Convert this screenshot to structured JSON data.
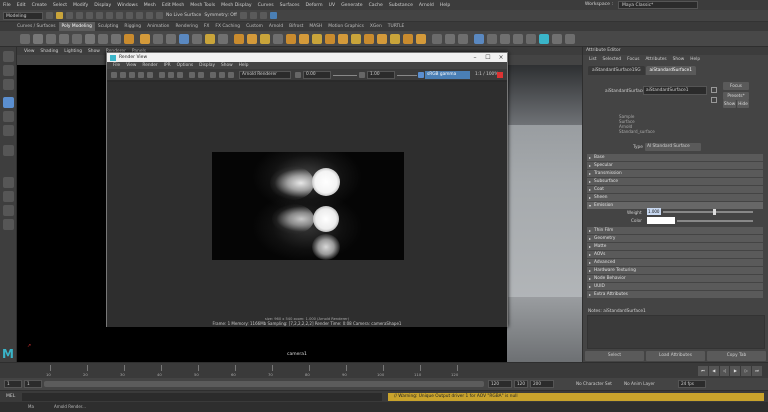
{
  "menubar": {
    "items": [
      "File",
      "Edit",
      "Create",
      "Select",
      "Modify",
      "Display",
      "Windows",
      "Mesh",
      "Edit Mesh",
      "Mesh Tools",
      "Mesh Display",
      "Curves",
      "Surfaces",
      "Deform",
      "UV",
      "Generate",
      "Cache",
      "Substance",
      "Arnold",
      "Help"
    ],
    "workspace_label": "Workspace :",
    "workspace_value": "Maya Classic*"
  },
  "statusline": {
    "menuset": "Modeling",
    "live_surface": "No Live Surface",
    "symmetry": "Symmetry: Off"
  },
  "shelf_tabs": [
    "Curves / Surfaces",
    "Poly Modeling",
    "Sculpting",
    "Rigging",
    "Animation",
    "Rendering",
    "FX",
    "FX Caching",
    "Custom",
    "Arnold",
    "Bifrost",
    "MASH",
    "Motion Graphics",
    "XGen",
    "TURTLE"
  ],
  "shelf_active_tab": 1,
  "viewport": {
    "menus": [
      "View",
      "Shading",
      "Lighting",
      "Show",
      "Renderer",
      "Panels"
    ],
    "camera_label": "camera1"
  },
  "render_view": {
    "title": "Render View",
    "menus": [
      "File",
      "View",
      "Render",
      "IPR",
      "Options",
      "Display",
      "Show",
      "Help"
    ],
    "renderer": "Arnold Renderer",
    "exposure": "0.00",
    "gamma": "1.00",
    "color_space": "sRGB gamma",
    "ratio": "1:1 / 100%",
    "info_line1": "size: 960 x 540  zoom: 1.000    (Arnold Renderer)",
    "info_line2": "Frame: 1    Memory: 1166Mb    Sampling: [7,2,2,2,2,2]    Render Time: 0:08    Camera: cameraShape1"
  },
  "attribute_editor": {
    "header": "Attribute Editor",
    "menus": [
      "List",
      "Selected",
      "Focus",
      "Attributes",
      "Show",
      "Help"
    ],
    "tabs": [
      "aiStandardSurface1SG",
      "aiStandardSurface1"
    ],
    "active_tab": 1,
    "shader_label": "aiStandardSurface:",
    "shader_name": "aiStandardSurface1",
    "focus_btn": "Focus",
    "presets_btn": "Presets*",
    "show_btn": "Show",
    "hide_btn": "Hide",
    "swatch_info": [
      "Sample",
      "Surface",
      "Arnold",
      "Standard_surface"
    ],
    "type_label": "Type",
    "type_value": "Al Standard Surface",
    "sections": [
      "Base",
      "Specular",
      "Transmission",
      "Subsurface",
      "Coat",
      "Sheen",
      "Emission"
    ],
    "emission_weight_label": "Weight",
    "emission_weight": "1.000",
    "emission_color_label": "Color",
    "sections_after": [
      "Thin Film",
      "Geometry",
      "Matte",
      "AOVs",
      "Advanced",
      "Hardware Texturing",
      "Node Behavior",
      "UUID",
      "Extra Attributes"
    ],
    "notes_label": "Notes:  aiStandardSurface1",
    "bottom_buttons": [
      "Select",
      "Load Attributes",
      "Copy Tab"
    ]
  },
  "timeline": {
    "ticks": [
      "10",
      "20",
      "30",
      "40",
      "50",
      "60",
      "70",
      "80",
      "90",
      "100",
      "110",
      "120"
    ]
  },
  "range": {
    "start": "1",
    "current": "1",
    "end": "120",
    "end2": "120",
    "end3": "200",
    "character_set": "No Character Set",
    "anim_layer": "No Anim Layer",
    "fps": "24 fps"
  },
  "cmdline": {
    "label": "MEL",
    "warning": "// Warning: Unique Output driver 1 for AOV \"RGBA\" is null"
  },
  "helpline": {
    "left": "Ma",
    "right": "Arnold Render..."
  },
  "colors": {
    "accent": "#5b8fd0",
    "warning_bg": "#c9a32c",
    "maya_logo": "#3ab5c9"
  }
}
